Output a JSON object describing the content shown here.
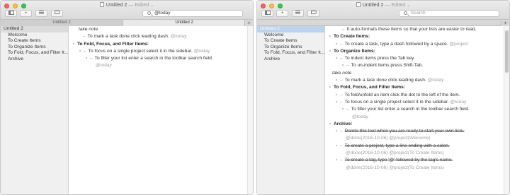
{
  "left_window": {
    "title": "Untitled 2",
    "title_separator": " — ",
    "title_status": "Edited",
    "title_chevron": "⌄",
    "toolbar": {
      "sidebar_toggle_icon": "sidebar-icon",
      "add_label": "+",
      "list_icon": "list-icon",
      "tag_icon": "tag-icon"
    },
    "search": {
      "value": "@today",
      "placeholder": "Search"
    },
    "tabs": [
      {
        "label": "Untitled 2",
        "active": false
      },
      {
        "label": "Untitled 2",
        "active": true
      }
    ],
    "tab_add_label": "+",
    "sidebar": {
      "root": "Untitled 2",
      "items": [
        "Welcome",
        "To Create Items",
        "To Organize Items",
        "To Fold, Focus, and Filter It...",
        "Archive"
      ]
    },
    "editor": {
      "l1": "take note",
      "l2_text": "To mark a task done click leading dash.",
      "l2_tag": "@today",
      "l3": "To Fold, Focus, and Filter Items:",
      "l4_text": "To focus on a single project select it in the sidebar.",
      "l4_tag": "@today",
      "l5_text": "To filter your list enter a search in the toolbar search field.",
      "l6_tag": "@today"
    }
  },
  "right_window": {
    "title": "Untitled 2",
    "title_separator": " — ",
    "title_status": "Edited",
    "title_chevron": "⌄",
    "toolbar": {
      "sidebar_toggle_icon": "sidebar-icon",
      "add_label": "+",
      "list_icon": "list-icon",
      "tag_icon": "tag-icon"
    },
    "search": {
      "value": "",
      "placeholder": "Search"
    },
    "tab_add_label": "+",
    "sidebar": {
      "root": "Untitled 2",
      "items": [
        "Welcome",
        "To Create Items",
        "To Organize Items",
        "To Fold, Focus, and Filter It...",
        "Archive"
      ]
    },
    "editor": {
      "r1": "It auto-formats these items so that your lists are easier to read.",
      "r2": "To Create Items:",
      "r3_text": "To create a task, type a dash followed by a space.",
      "r3_tag": "@project",
      "r4": "To Organize Items:",
      "r5": "To indent items press the Tab key.",
      "r6": "To un-indent items press Shift-Tab.",
      "r7": "take note",
      "r8_text": "To mark a task done click leading dash.",
      "r8_tag": "@today",
      "r9": "To Fold, Focus, and Filter Items:",
      "r10": "To fold/unfold an item click the dot to the left of the item.",
      "r11_text": "To focus on a single project select it in the sidebar.",
      "r11_tag": "@today",
      "r12": "To filter your list enter a search in the toolbar search field.",
      "r13_tag": "@today",
      "r14": "Archive:",
      "r15": "Delete this text when you are ready to start your own lists.",
      "r16_tag": "@done(2016-10-06) @project(Welcome)",
      "r17": "To create a project, type a line ending with a colon.",
      "r18_tag": "@done(2016-10-06) @project(To Create Items)",
      "r19": "To create a tag, type '@' followed by the tag's name.",
      "r20_tag": "@done(2016-10-06) @project(To Create Items)"
    }
  },
  "colors": {
    "close": "#fc605c",
    "minimize": "#fdbc40",
    "zoom": "#34c84a",
    "sidebar_bg": "#f0f0f0",
    "tag_gray": "#a0a0a0"
  }
}
